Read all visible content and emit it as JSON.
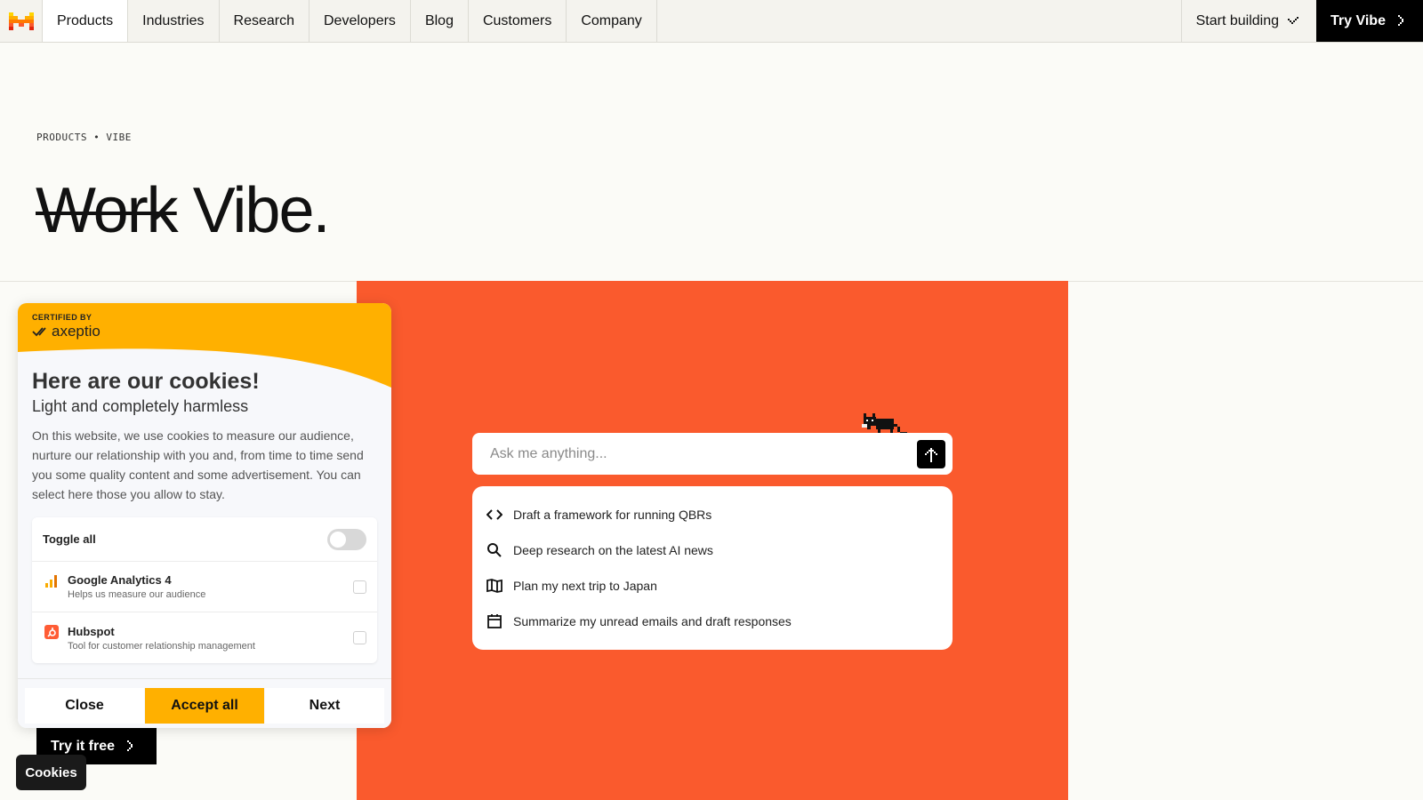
{
  "nav": {
    "items": [
      {
        "label": "Products"
      },
      {
        "label": "Industries"
      },
      {
        "label": "Research"
      },
      {
        "label": "Developers"
      },
      {
        "label": "Blog"
      },
      {
        "label": "Customers"
      },
      {
        "label": "Company"
      }
    ],
    "start_building": "Start building",
    "try_vibe": "Try Vibe"
  },
  "hero": {
    "breadcrumb": "PRODUCTS • VIBE",
    "title_struck": "Work",
    "title_rest": " Vibe."
  },
  "prompt": {
    "placeholder": "Ask me anything..."
  },
  "suggestions": [
    {
      "icon": "code-icon",
      "label": "Draft a framework for running QBRs"
    },
    {
      "icon": "search-icon",
      "label": "Deep research on the latest AI news"
    },
    {
      "icon": "map-icon",
      "label": "Plan my next trip to Japan"
    },
    {
      "icon": "calendar-icon",
      "label": "Summarize my unread emails and draft responses"
    }
  ],
  "cookie": {
    "certified_by": "CERTIFIED BY",
    "brand": "axeptio",
    "title": "Here are our cookies!",
    "subtitle": "Light and completely harmless",
    "description": "On this website, we use cookies to measure our audience, nurture our relationship with you and, from time to time send you some quality content and some advertisement. You can select here those you allow to stay.",
    "toggle_all": "Toggle all",
    "vendors": [
      {
        "name": "Google Analytics 4",
        "desc": "Helps us measure our audience"
      },
      {
        "name": "Hubspot",
        "desc": "Tool for customer relationship management"
      }
    ],
    "close": "Close",
    "accept_all": "Accept all",
    "next": "Next"
  },
  "try_free": "Try it free",
  "cookies_pill": "Cookies",
  "colors": {
    "accent_orange": "#fa5a2d",
    "cookie_yellow": "#ffb000",
    "black": "#000000"
  }
}
